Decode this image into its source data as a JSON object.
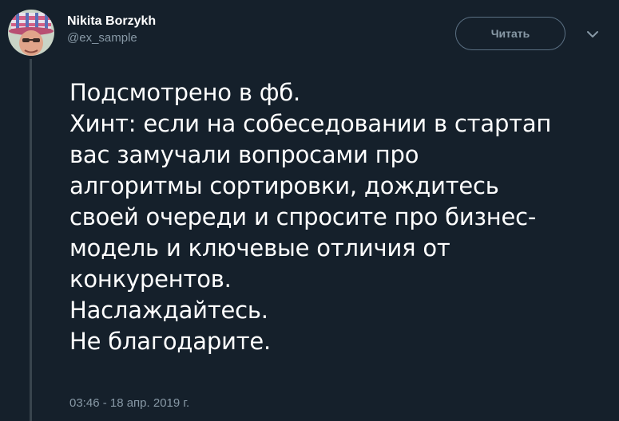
{
  "author": {
    "display_name": "Nikita Borzykh",
    "handle": "@ex_sample"
  },
  "follow_button": {
    "label": "Читать"
  },
  "tweet": {
    "lines": [
      "Подсмотрено в фб.",
      "Хинт: если на собеседовании в стартап",
      "вас замучали вопросами про",
      "алгоритмы сортировки, дождитесь",
      "своей очереди и спросите про бизнес-",
      "модель и ключевые отличия от",
      "конкурентов.",
      "Наслаждайтесь.",
      "Не благодарите."
    ],
    "timestamp": "03:46 - 18 апр. 2019 г."
  },
  "icons": {
    "menu": "chevron-down-icon",
    "avatar": "avatar"
  },
  "colors": {
    "background": "#15202b",
    "text": "#ffffff",
    "secondary_text": "#8899a6",
    "button_border": "#5b7083",
    "thread_line": "#38444d"
  }
}
